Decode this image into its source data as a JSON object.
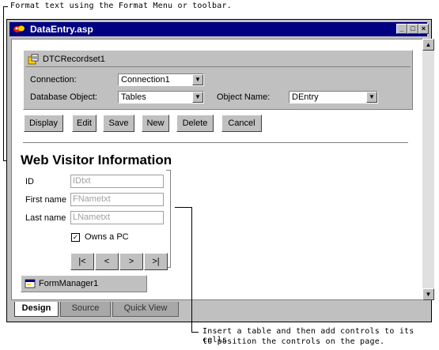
{
  "callouts": {
    "top": "Format text using the Format Menu or toolbar.",
    "bottom_line1": "Insert a table and then add controls to its cells",
    "bottom_line2": "to position the controls on the page."
  },
  "window": {
    "title": "DataEntry.asp",
    "controls": {
      "minimize": "_",
      "maximize": "□",
      "close": "×"
    }
  },
  "recordset": {
    "name": "DTCRecordset1",
    "connection_label": "Connection:",
    "connection_value": "Connection1",
    "db_object_label": "Database Object:",
    "db_object_value": "Tables",
    "object_name_label": "Object Name:",
    "object_name_value": "DEntry"
  },
  "action_buttons": [
    "Display",
    "Edit",
    "Save",
    "New",
    "Delete",
    "Cancel"
  ],
  "form": {
    "heading": "Web Visitor Information",
    "fields": [
      {
        "label": "ID",
        "value": "IDtxt"
      },
      {
        "label": "First name",
        "value": "FNametxt"
      },
      {
        "label": "Last name",
        "value": "LNametxt"
      }
    ],
    "checkbox_label": "Owns a PC",
    "checkbox_checked": true
  },
  "nav_buttons": [
    "|<",
    "<",
    ">",
    ">|"
  ],
  "form_manager": "FormManager1",
  "tabs": [
    "Design",
    "Source",
    "Quick View"
  ],
  "active_tab": "Design"
}
